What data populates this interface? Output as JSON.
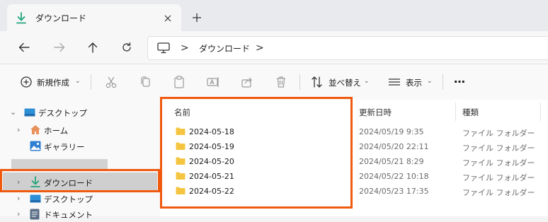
{
  "tab": {
    "title": "ダウンロード",
    "close_glyph": "✕",
    "new_tab_glyph": "+"
  },
  "address": {
    "crumbs": [
      "ダウンロード"
    ],
    "separator": ">"
  },
  "toolbar": {
    "new_label": "新規作成",
    "sort_label": "並べ替え",
    "view_label": "表示",
    "more_glyph": "…",
    "dropdown_glyph": "⌄"
  },
  "nav": {
    "items": [
      {
        "label": "デスクトップ",
        "icon": "desktop-icon"
      },
      {
        "label": "ホーム",
        "icon": "home-icon"
      },
      {
        "label": "ギャラリー",
        "icon": "gallery-icon"
      },
      {
        "label": "ダウンロード",
        "icon": "download-icon"
      },
      {
        "label": "デスクトップ",
        "icon": "desktop-icon"
      },
      {
        "label": "ドキュメント",
        "icon": "documents-icon"
      }
    ],
    "expander_glyph": "›",
    "expanded_glyph": "⌄"
  },
  "columns": {
    "name": "名前",
    "modified": "更新日時",
    "type": "種類"
  },
  "files": [
    {
      "name": "2024-05-18",
      "modified": "2024/05/19 9:35",
      "type": "ファイル フォルダー"
    },
    {
      "name": "2024-05-19",
      "modified": "2024/05/20 22:11",
      "type": "ファイル フォルダー"
    },
    {
      "name": "2024-05-20",
      "modified": "2024/05/21 8:29",
      "type": "ファイル フォルダー"
    },
    {
      "name": "2024-05-21",
      "modified": "2024/05/22 10:18",
      "type": "ファイル フォルダー"
    },
    {
      "name": "2024-05-22",
      "modified": "2024/05/23 17:35",
      "type": "ファイル フォルダー"
    }
  ],
  "colors": {
    "accent_download": "#20a37a",
    "highlight_box": "#f05a0f",
    "folder": "#f5c542"
  }
}
